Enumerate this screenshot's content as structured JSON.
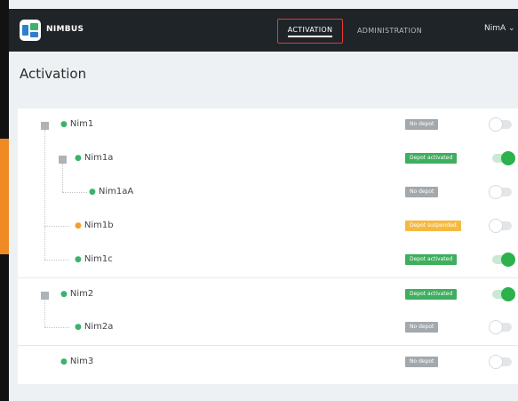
{
  "header": {
    "brand": "NIMBUS",
    "nav": {
      "activation": "ACTIVATION",
      "administration": "ADMINISTRATION"
    },
    "user": "NimA ⌄"
  },
  "page": {
    "title": "Activation"
  },
  "tree": [
    {
      "label": "Nim1",
      "dot_color": "green",
      "status": "No depot",
      "badge_color": "#a3a8ad",
      "toggle": "off"
    },
    {
      "label": "Nim1a",
      "dot_color": "green",
      "status": "Depot activated",
      "badge_color": "#3fae5e",
      "toggle": "on"
    },
    {
      "label": "Nim1aA",
      "dot_color": "green",
      "status": "No depot",
      "badge_color": "#a3a8ad",
      "toggle": "off"
    },
    {
      "label": "Nim1b",
      "dot_color": "orange",
      "status": "Depot suspended",
      "badge_color": "#f5b942",
      "toggle": "off"
    },
    {
      "label": "Nim1c",
      "dot_color": "green",
      "status": "Depot activated",
      "badge_color": "#3fae5e",
      "toggle": "on"
    },
    {
      "label": "Nim2",
      "dot_color": "green",
      "status": "Depot activated",
      "badge_color": "#3fae5e",
      "toggle": "on"
    },
    {
      "label": "Nim2a",
      "dot_color": "green",
      "status": "No depot",
      "badge_color": "#a3a8ad",
      "toggle": "off"
    },
    {
      "label": "Nim3",
      "dot_color": "green",
      "status": "No depot",
      "badge_color": "#a3a8ad",
      "toggle": "off"
    }
  ],
  "colors": {
    "accent_green": "#2db14d",
    "highlight_orange": "#f08a24",
    "nav_border": "#e53935"
  }
}
